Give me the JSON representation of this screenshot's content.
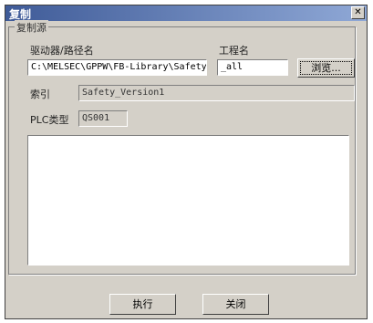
{
  "window": {
    "title": "复制",
    "close_glyph": "✕"
  },
  "group": {
    "label": "复制源"
  },
  "drive_path": {
    "label": "驱动器/路径名",
    "value": "C:\\MELSEC\\GPPW\\FB-Library\\Safety"
  },
  "project": {
    "label": "工程名",
    "value": "_all"
  },
  "browse": {
    "label": "浏览..."
  },
  "index": {
    "label": "索引",
    "value": "Safety_Version1"
  },
  "plc_type": {
    "label": "PLC类型",
    "value": "QS001"
  },
  "buttons": {
    "execute": "执行",
    "close": "关闭"
  }
}
